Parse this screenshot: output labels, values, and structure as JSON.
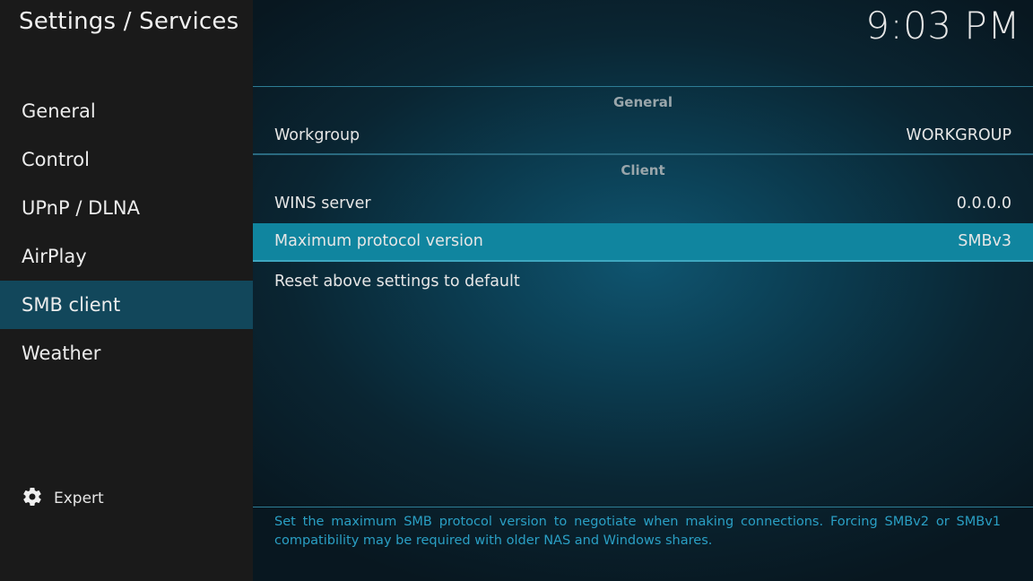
{
  "header": {
    "title": "Settings / Services",
    "clock": "9:03 PM"
  },
  "sidebar": {
    "items": [
      {
        "label": "General",
        "active": false
      },
      {
        "label": "Control",
        "active": false
      },
      {
        "label": "UPnP / DLNA",
        "active": false
      },
      {
        "label": "AirPlay",
        "active": false
      },
      {
        "label": "SMB client",
        "active": true
      },
      {
        "label": "Weather",
        "active": false
      }
    ],
    "expert": {
      "label": "Expert",
      "icon": "gear-icon"
    }
  },
  "settings": {
    "groups": [
      {
        "header": "General",
        "rows": [
          {
            "label": "Workgroup",
            "value": "WORKGROUP"
          }
        ]
      },
      {
        "header": "Client",
        "rows": [
          {
            "label": "WINS server",
            "value": "0.0.0.0"
          },
          {
            "label": "Maximum protocol version",
            "value": "SMBv3",
            "focused": true
          }
        ]
      }
    ],
    "reset_label": "Reset above settings to default"
  },
  "description": "Set the maximum SMB protocol version to negotiate when making connections. Forcing SMBv2 or SMBv1 compatibility may be required with older NAS and Windows shares.",
  "colors": {
    "sidebar_active": "#12475b",
    "row_focused": "#10859f",
    "description_text": "#2a9fc4"
  }
}
